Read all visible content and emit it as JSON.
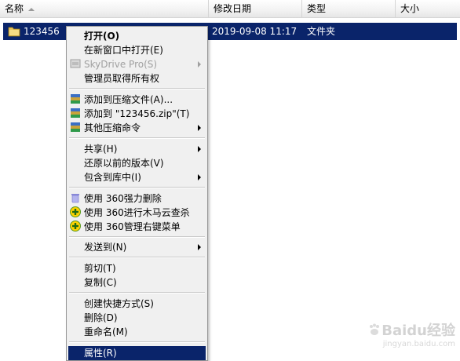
{
  "header": {
    "name": "名称",
    "date_modified": "修改日期",
    "type": "类型",
    "size": "大小"
  },
  "file": {
    "name": "123456",
    "date": "2019-09-08 11:17",
    "type": "文件夹",
    "icon": "folder-icon"
  },
  "menu": {
    "open": "打开(O)",
    "open_new_window": "在新窗口中打开(E)",
    "skydrive": "SkyDrive Pro(S)",
    "take_ownership": "管理员取得所有权",
    "add_to_archive": "添加到压缩文件(A)...",
    "add_to_zip": "添加到 \"123456.zip\"(T)",
    "other_compress": "其他压缩命令",
    "share": "共享(H)",
    "restore_versions": "还原以前的版本(V)",
    "include_library": "包含到库中(I)",
    "force_delete_360": "使用 360强力删除",
    "trojan_scan_360": "使用 360进行木马云查杀",
    "manage_menu_360": "使用 360管理右键菜单",
    "send_to": "发送到(N)",
    "cut": "剪切(T)",
    "copy": "复制(C)",
    "create_shortcut": "创建快捷方式(S)",
    "delete": "删除(D)",
    "rename": "重命名(M)",
    "properties": "属性(R)"
  },
  "watermark": {
    "brand": "Baidu经验",
    "url": "jingyan.baidu.com"
  },
  "colors": {
    "selection": "#0a246a",
    "menu_bg": "#f0f0f0"
  }
}
